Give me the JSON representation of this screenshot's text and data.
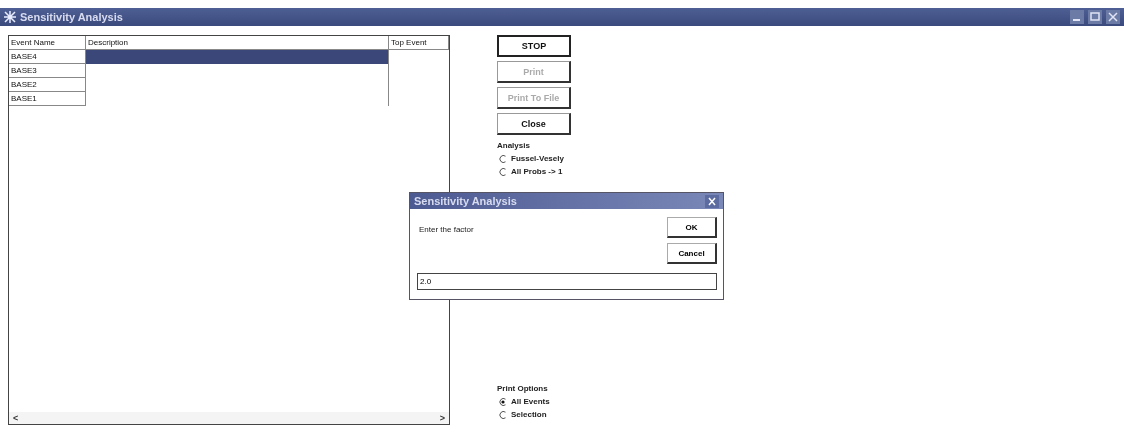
{
  "window": {
    "title": "Sensitivity Analysis"
  },
  "table": {
    "columns": [
      "Event Name",
      "Description",
      "Top Event"
    ],
    "rows": [
      {
        "cells": [
          "BASE4",
          "",
          ""
        ],
        "selected": true
      },
      {
        "cells": [
          "BASE3",
          "",
          ""
        ],
        "selected": false
      },
      {
        "cells": [
          "BASE2",
          "",
          ""
        ],
        "selected": false
      },
      {
        "cells": [
          "BASE1",
          "",
          ""
        ],
        "selected": false
      }
    ],
    "scroll_left": "<",
    "scroll_right": ">"
  },
  "buttons": [
    {
      "label": "STOP",
      "disabled": false,
      "default": true
    },
    {
      "label": "Print",
      "disabled": true,
      "default": false
    },
    {
      "label": "Print To File",
      "disabled": true,
      "default": false
    },
    {
      "label": "Close",
      "disabled": false,
      "default": false
    }
  ],
  "analysis": {
    "label": "Analysis",
    "options": [
      {
        "label": "Fussel-Vesely",
        "selected": false
      },
      {
        "label": "All Probs -> 1",
        "selected": false
      }
    ]
  },
  "print_options": {
    "label": "Print Options",
    "options": [
      {
        "label": "All Events",
        "selected": true
      },
      {
        "label": "Selection",
        "selected": false
      }
    ]
  },
  "dialog": {
    "title": "Sensitivity Analysis",
    "prompt": "Enter the factor",
    "buttons": [
      "OK",
      "Cancel"
    ],
    "field": {
      "value": "2.0"
    }
  }
}
